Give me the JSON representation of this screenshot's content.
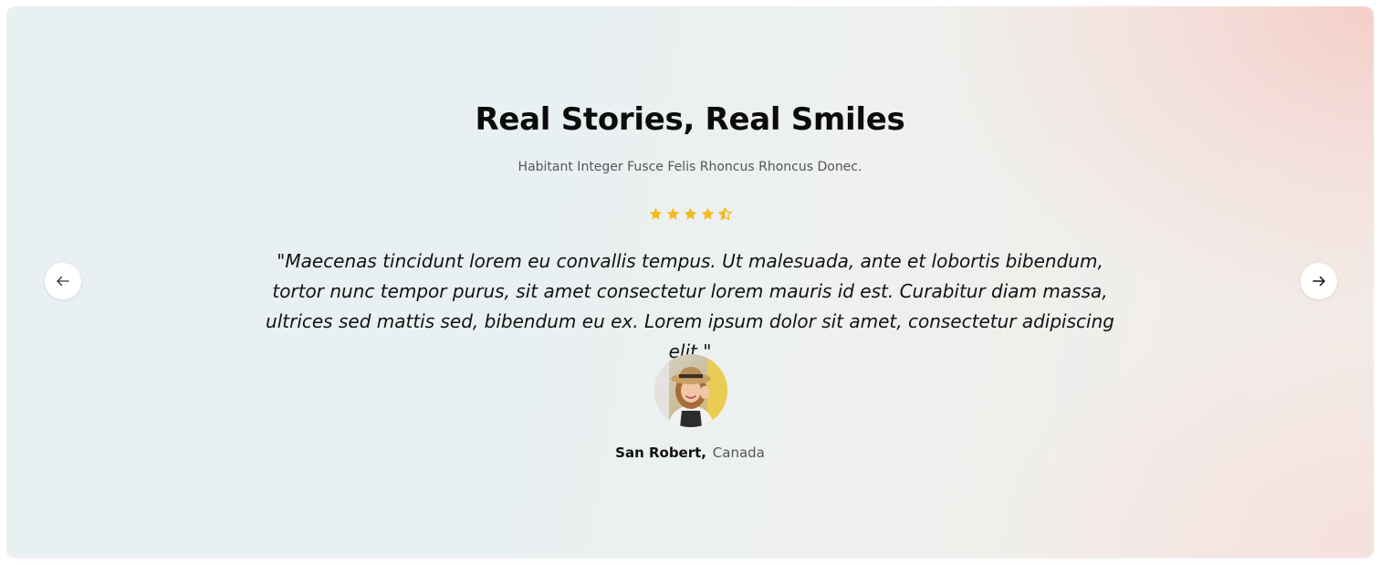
{
  "section": {
    "title": "Real Stories, Real Smiles",
    "subtitle": "Habitant Integer Fusce Felis Rhoncus Rhoncus Donec."
  },
  "testimonial": {
    "rating": 4.5,
    "rating_max": 5,
    "quote": "\"Maecenas tincidunt lorem eu convallis tempus. Ut malesuada, ante et lobortis bibendum, tortor nunc tempor purus, sit amet consectetur lorem mauris id est. Curabitur diam massa, ultrices sed mattis sed, bibendum eu ex. Lorem ipsum dolor sit amet, consectetur adipiscing elit.\"",
    "author_name": "San Robert,",
    "author_location": "Canada"
  },
  "navigation": {
    "prev_icon": "arrow-left-icon",
    "next_icon": "arrow-right-icon"
  },
  "colors": {
    "star": "#f5b921",
    "title": "#0b0b0b",
    "accent_bg": "#f5cdc8"
  }
}
